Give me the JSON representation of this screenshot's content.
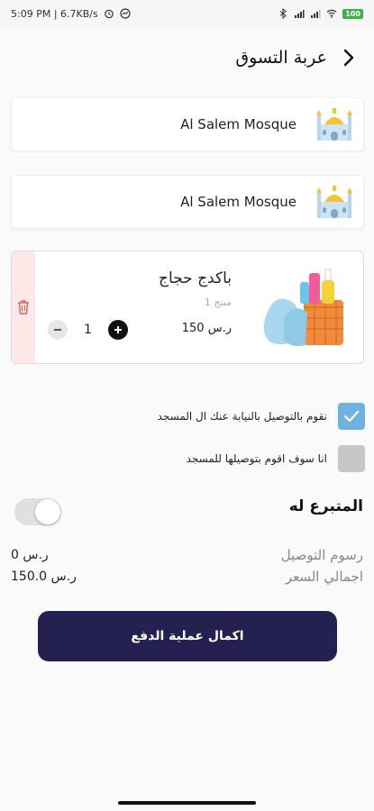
{
  "status_bar": {
    "time_speed": "5:09 PM | 6.7KB/s",
    "battery": "100"
  },
  "header": {
    "title": "عربة التسوق"
  },
  "mosques": [
    {
      "name": "Al Salem Mosque",
      "icon": "mosque-icon"
    },
    {
      "name": "Al Salem Mosque",
      "icon": "mosque-icon"
    }
  ],
  "cart_item": {
    "title": "باكدج حجاج",
    "count": "1 منتج",
    "price": "150 ر.س",
    "quantity": "1",
    "image": "cleaning-products-image"
  },
  "delivery_options": [
    {
      "label": "نقوم بالتوصيل بالنيابة عنك ال المسجد",
      "checked": true
    },
    {
      "label": "انا سوف اقوم بتوصيلها للمسجد",
      "checked": false
    }
  ],
  "donor": {
    "label": "المتبرع له",
    "toggle_on": false
  },
  "summary": {
    "delivery_label": "رسوم التوصيل",
    "delivery_value": "0 ر.س",
    "total_label": "اجمالي السعر",
    "total_value": "150.0 ر.س"
  },
  "checkout": {
    "button_label": "اكمال عملية الدفع"
  },
  "colors": {
    "primary": "#24204f",
    "check_blue": "#6fb2e0",
    "delete_red": "#e0605a"
  }
}
